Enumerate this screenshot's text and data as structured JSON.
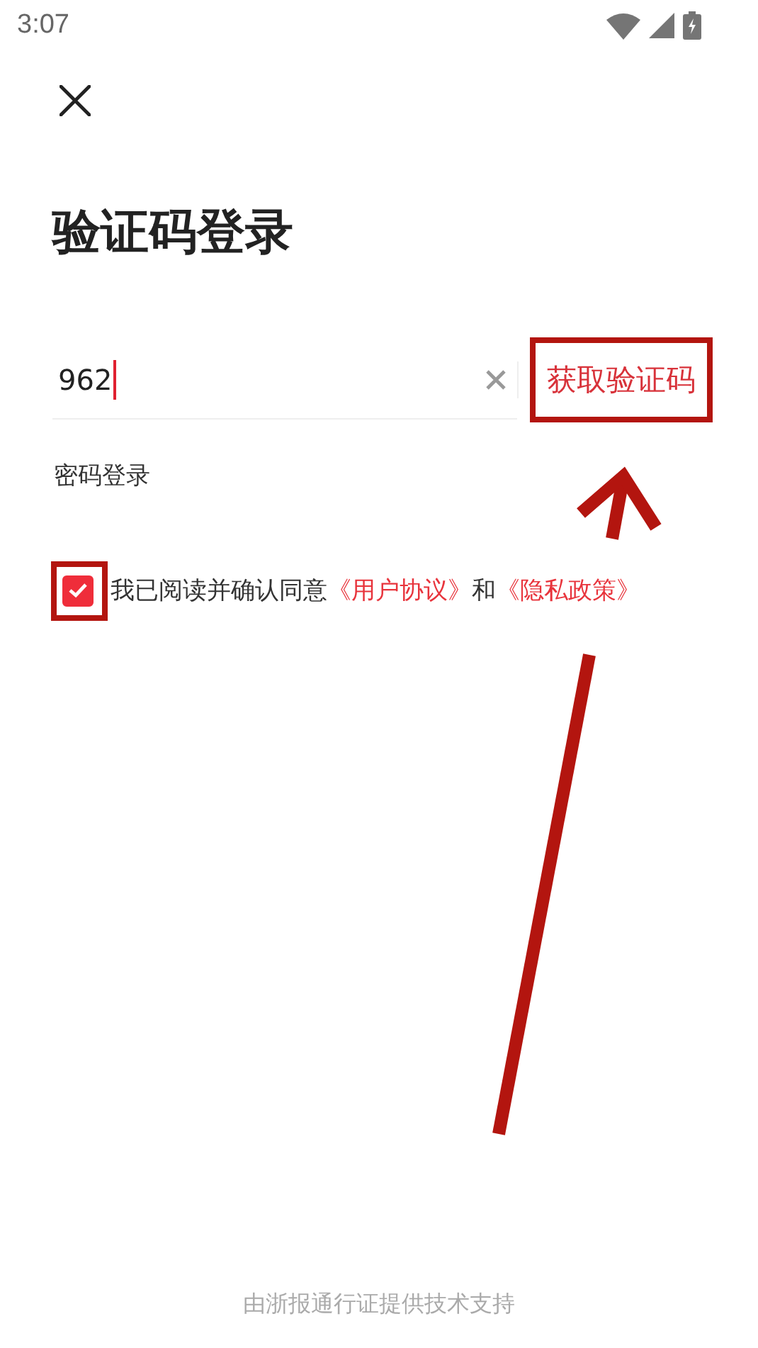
{
  "status_bar": {
    "time": "3:07"
  },
  "title": "验证码登录",
  "phone_field": {
    "value": "962"
  },
  "get_code_button": {
    "label": "获取验证码"
  },
  "password_login": {
    "label": "密码登录"
  },
  "agreement": {
    "checked": true,
    "parts": [
      {
        "kind": "text",
        "text": "我已阅读并确认同意"
      },
      {
        "kind": "link",
        "text": "《用户协议》"
      },
      {
        "kind": "text",
        "text": "和"
      },
      {
        "kind": "link",
        "text": "《隐私政策》"
      }
    ]
  },
  "footer": "由浙报通行证提供技术支持"
}
